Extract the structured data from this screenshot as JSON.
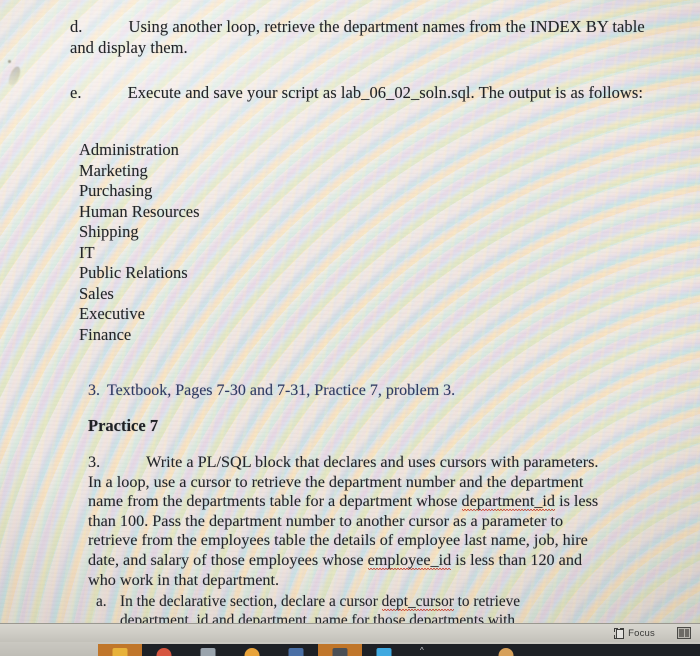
{
  "document": {
    "items": [
      {
        "marker": "d.",
        "text": "Using another loop, retrieve the department names from the INDEX BY table and display them."
      },
      {
        "marker": "e.",
        "text": "Execute and save your script as lab_06_02_soln.sql. The output is as follows:"
      }
    ],
    "output_list": [
      "Administration",
      "Marketing",
      "Purchasing",
      "Human Resources",
      "Shipping",
      "IT",
      "Public Relations",
      "Sales",
      "Executive",
      "Finance"
    ],
    "reference": {
      "number": "3.",
      "text": "Textbook, Pages 7-30 and 7-31, Practice 7, problem 3.",
      "color": "#2f3b63"
    },
    "practice_heading": "Practice 7",
    "body": {
      "marker": "3.",
      "part1": "Write a PL/SQL block that declares and uses cursors with parameters. In a loop, use a cursor to retrieve the department number and the department name from the departments table for a department whose ",
      "spell1": "department_id",
      "part2": " is less than 100. Pass the department number to another cursor as a parameter to retrieve from the employees table the details of employee last name, job, hire date, and salary of those employees whose ",
      "spell2": "employee_id",
      "part3": " is less than 120 and who work in that department."
    },
    "sub_item": {
      "marker": "a.",
      "part1": "In the declarative section, declare a cursor ",
      "spell1": "dept_cursor",
      "part2": " to retrieve",
      "line2": "department_id and department_name for those departments with"
    }
  },
  "statusbar": {
    "focus_label": "Focus",
    "focus_icon": "focus-mode-icon",
    "view_icon": "multiple-pages-view-icon",
    "background": "#cfcdc6"
  },
  "taskbar": {
    "background": "#1e2126",
    "overflow_caret": "^",
    "apps": [
      {
        "name": "app-folder",
        "color": "#e8b23a",
        "highlight": "#c0762a",
        "shape": "square"
      },
      {
        "name": "app-red-circle",
        "color": "#d6553f",
        "highlight": "",
        "shape": "round"
      },
      {
        "name": "app-window-grey",
        "color": "#9aa4ad",
        "highlight": "",
        "shape": "square"
      },
      {
        "name": "app-orange-circle",
        "color": "#e8a33a",
        "highlight": "",
        "shape": "round"
      },
      {
        "name": "app-blue-glyph",
        "color": "#4a6fa5",
        "highlight": "",
        "shape": "square"
      },
      {
        "name": "app-notes",
        "color": "#4b4f55",
        "highlight": "#c0762a",
        "shape": "square"
      },
      {
        "name": "app-cyan-window",
        "color": "#3fa9e0",
        "highlight": "",
        "shape": "square"
      }
    ],
    "tray_apps": [
      {
        "name": "tray-avatar",
        "color": "#d6a05a",
        "shape": "round"
      }
    ]
  },
  "page": {
    "background": "#efe9df",
    "text_color": "#23262b",
    "spellcheck_underline_color": "#c4321f"
  }
}
